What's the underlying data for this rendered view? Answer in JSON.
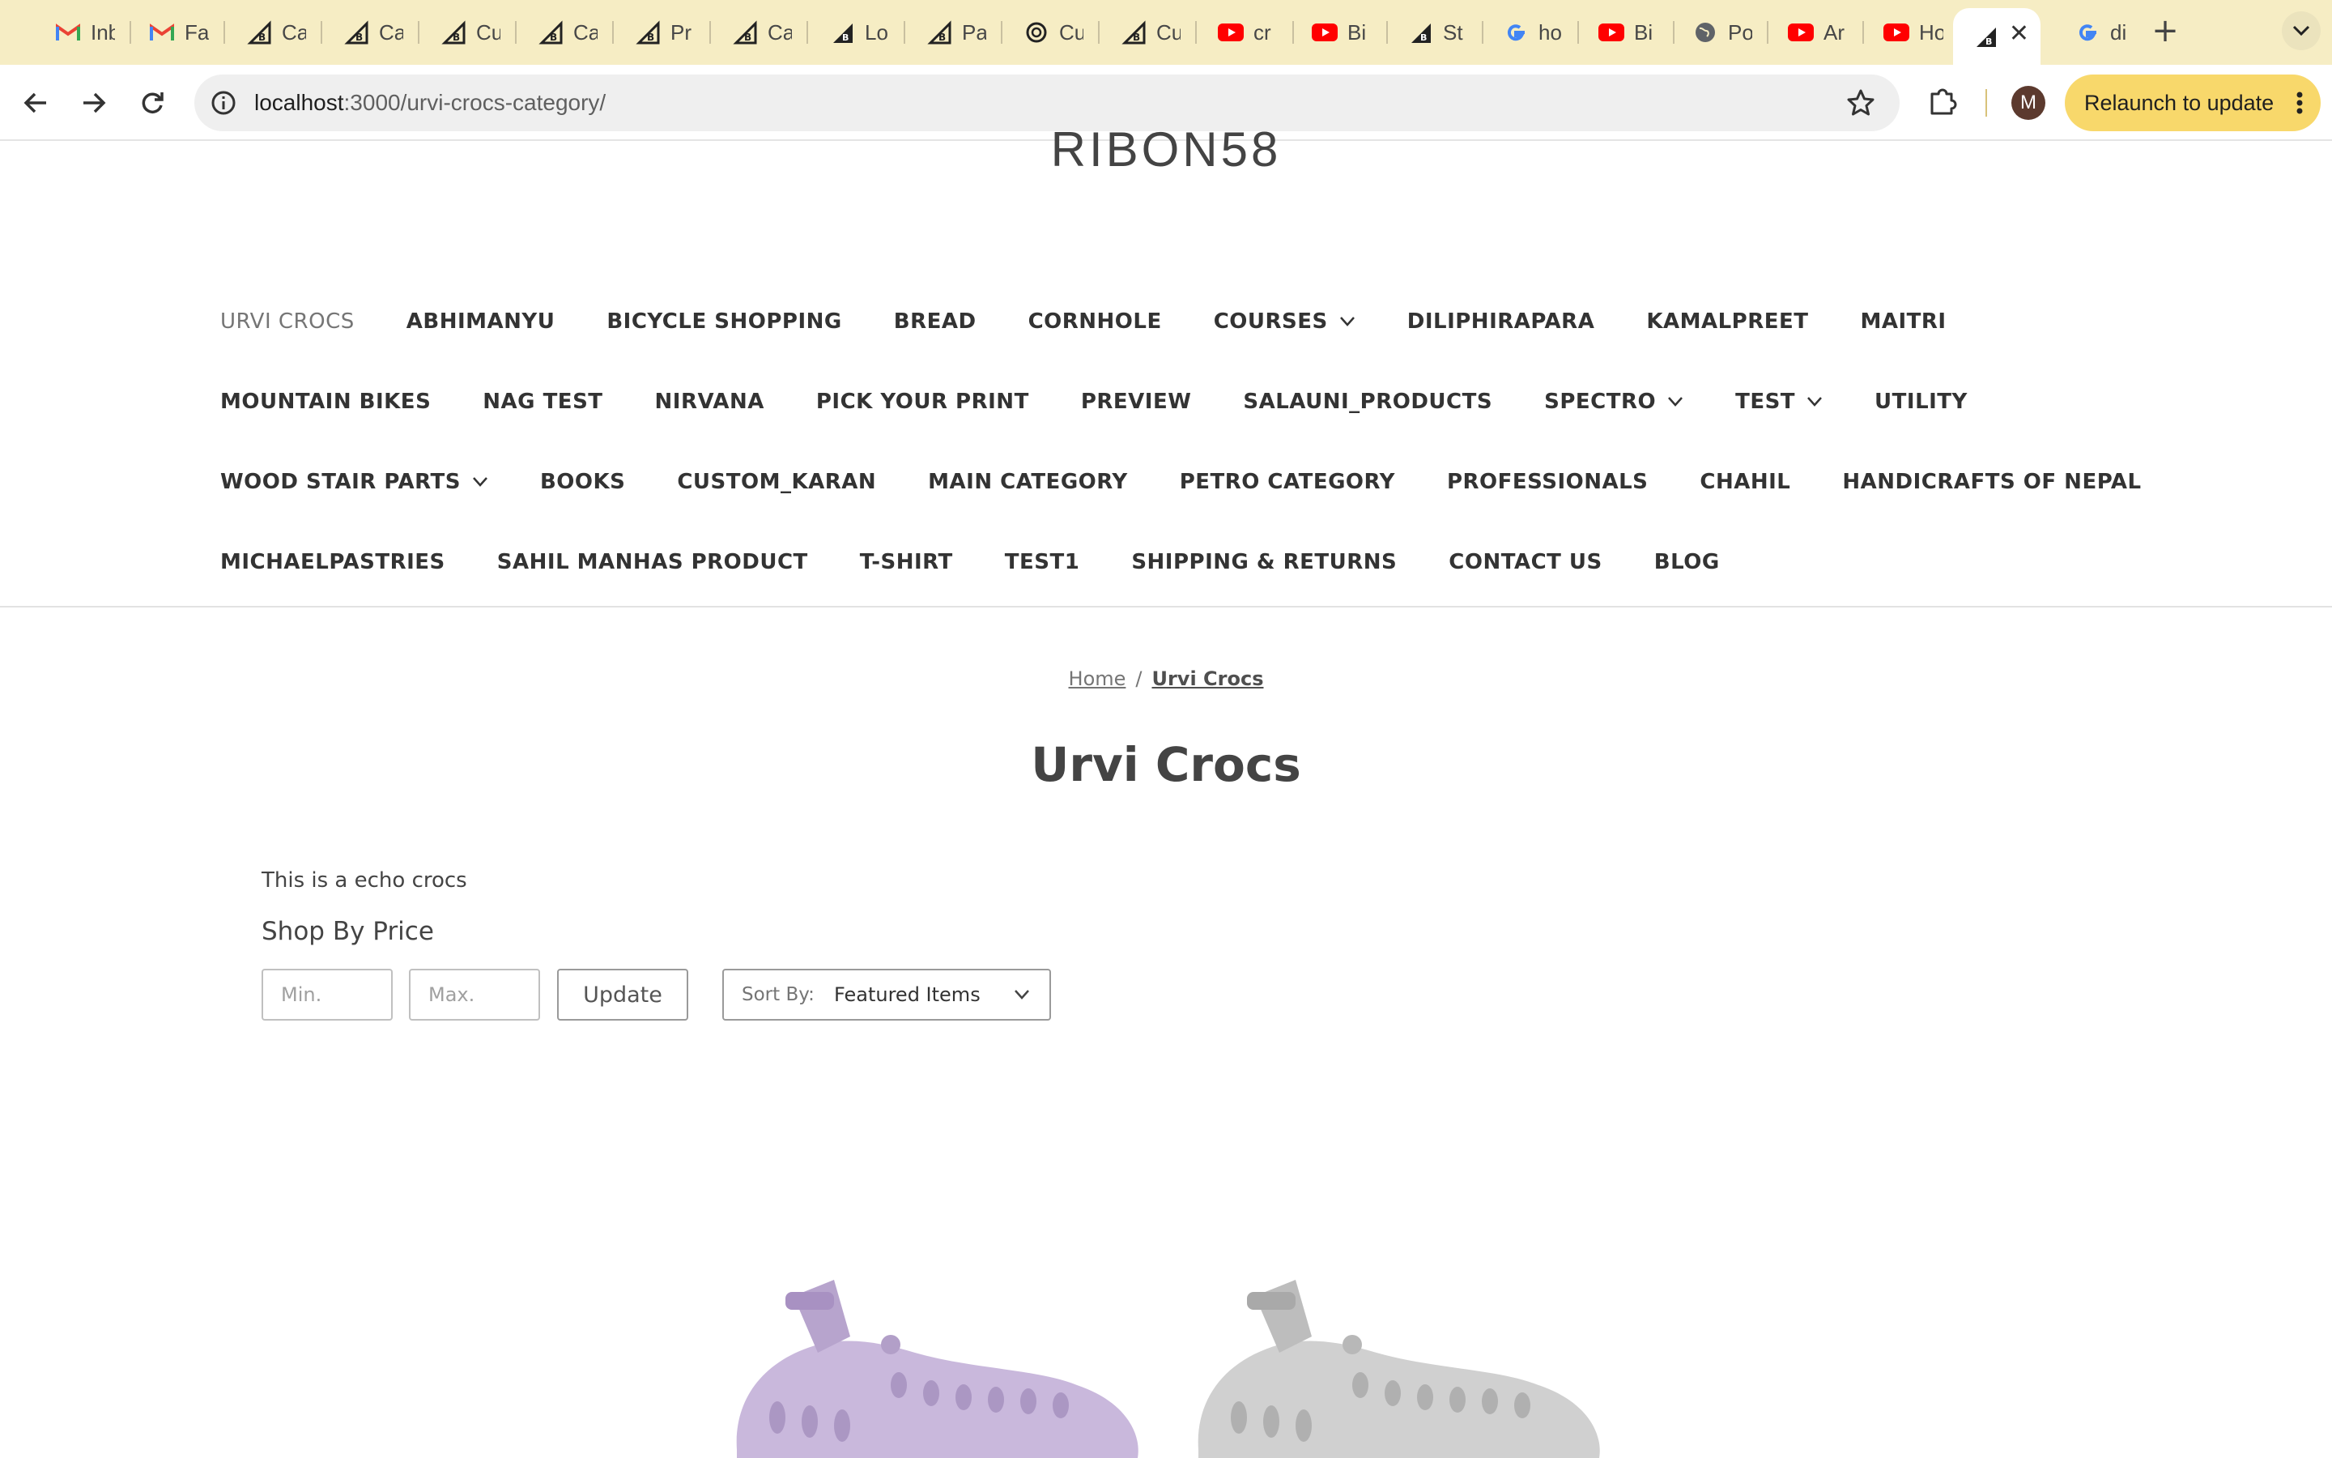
{
  "browser": {
    "tabs": [
      {
        "title": "Inbox",
        "icon": "gmail-icon"
      },
      {
        "title": "Fa",
        "icon": "gmail-icon"
      },
      {
        "title": "Ca",
        "icon": "bigcommerce-icon"
      },
      {
        "title": "Ca",
        "icon": "bigcommerce-icon"
      },
      {
        "title": "Cu",
        "icon": "bigcommerce-icon"
      },
      {
        "title": "Ca",
        "icon": "bigcommerce-icon"
      },
      {
        "title": "Pr",
        "icon": "bigcommerce-icon"
      },
      {
        "title": "Ca",
        "icon": "bigcommerce-icon"
      },
      {
        "title": "Lo",
        "icon": "bigcommerce-dark-icon"
      },
      {
        "title": "Pa",
        "icon": "bigcommerce-icon"
      },
      {
        "title": "Cu",
        "icon": "chatgpt-icon"
      },
      {
        "title": "Cu",
        "icon": "bigcommerce-icon"
      },
      {
        "title": "cr",
        "icon": "youtube-icon"
      },
      {
        "title": "Bi",
        "icon": "youtube-icon"
      },
      {
        "title": "St",
        "icon": "bigcommerce-dark-icon"
      },
      {
        "title": "ho",
        "icon": "google-icon"
      },
      {
        "title": "Bi",
        "icon": "youtube-icon"
      },
      {
        "title": "Po",
        "icon": "globe-icon"
      },
      {
        "title": "Ar",
        "icon": "youtube-icon"
      },
      {
        "title": "Ho",
        "icon": "youtube-icon"
      },
      {
        "title": "",
        "icon": "bigcommerce-dark-icon",
        "active": true
      },
      {
        "title": "di",
        "icon": "google-icon"
      }
    ],
    "url_host": "localhost",
    "url_path": ":3000/urvi-crocs-category/",
    "profile_initial": "M",
    "relaunch_label": "Relaunch to update"
  },
  "store": {
    "logo": "RIBON58"
  },
  "nav": {
    "rows": [
      [
        {
          "label": "URVI CROCS",
          "current": true
        },
        {
          "label": "ABHIMANYU"
        },
        {
          "label": "BICYCLE SHOPPING"
        },
        {
          "label": "BREAD"
        },
        {
          "label": "CORNHOLE"
        },
        {
          "label": "COURSES",
          "dropdown": true
        },
        {
          "label": "DILIPHIRAPARA"
        },
        {
          "label": "KAMALPREET"
        },
        {
          "label": "MAITRI"
        }
      ],
      [
        {
          "label": "MOUNTAIN BIKES"
        },
        {
          "label": "NAG TEST"
        },
        {
          "label": "NIRVANA"
        },
        {
          "label": "PICK YOUR PRINT"
        },
        {
          "label": "PREVIEW"
        },
        {
          "label": "SALAUNI_PRODUCTS"
        },
        {
          "label": "SPECTRO",
          "dropdown": true
        },
        {
          "label": "TEST",
          "dropdown": true
        },
        {
          "label": "UTILITY"
        }
      ],
      [
        {
          "label": "WOOD STAIR PARTS",
          "dropdown": true
        },
        {
          "label": "BOOKS"
        },
        {
          "label": "CUSTOM_KARAN"
        },
        {
          "label": "MAIN CATEGORY"
        },
        {
          "label": "PETRO CATEGORY"
        },
        {
          "label": "PROFESSIONALS"
        },
        {
          "label": "CHAHIL"
        },
        {
          "label": "HANDICRAFTS OF NEPAL"
        }
      ],
      [
        {
          "label": "MICHAELPASTRIES"
        },
        {
          "label": "SAHIL MANHAS PRODUCT"
        },
        {
          "label": "T-SHIRT"
        },
        {
          "label": "TEST1"
        },
        {
          "label": "SHIPPING & RETURNS"
        },
        {
          "label": "CONTACT US"
        },
        {
          "label": "BLOG"
        }
      ]
    ]
  },
  "breadcrumb": {
    "home": "Home",
    "separator": "/",
    "current": "Urvi Crocs"
  },
  "page": {
    "heading": "Urvi Crocs",
    "description": "This is a echo crocs"
  },
  "filters": {
    "title": "Shop By Price",
    "min_placeholder": "Min.",
    "max_placeholder": "Max.",
    "update_label": "Update",
    "sort_label": "Sort By:",
    "sort_value": "Featured Items"
  },
  "products": [
    {
      "image": "lavender-clog-image",
      "color": "#c9b8dc"
    },
    {
      "image": "grey-clog-image",
      "color": "#c8c8c8"
    }
  ],
  "colors": {
    "tabstrip": "#f6edc4",
    "relaunch": "#f8d86b",
    "text": "#333333"
  }
}
